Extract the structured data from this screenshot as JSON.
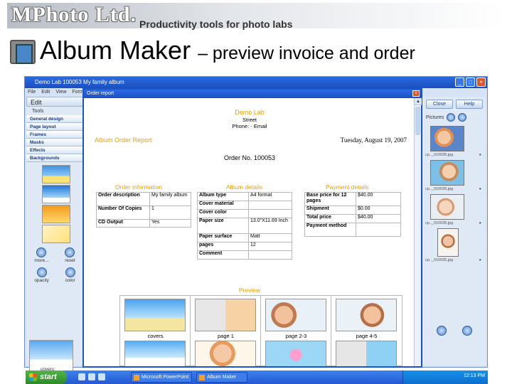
{
  "slide": {
    "logo": "MPhoto Ltd.",
    "tagline": "Productivity tools for photo labs",
    "title": "Album Maker",
    "subtitle": "– preview invoice and order"
  },
  "app": {
    "title": "Demo Lab    100053   My family album",
    "menu": [
      "File",
      "Edit",
      "View",
      "Format"
    ],
    "edit_header": "Edit",
    "tools_label": "Tools",
    "tools": [
      "General design",
      "Page layout",
      "Frames",
      "Masks",
      "Effects",
      "Backgrounds"
    ],
    "more_label": "more...",
    "reset_label": "reset",
    "opacity_label": "opacity",
    "color_label": "color",
    "covers_label": "covers",
    "close_label": "Close",
    "help_label": "Help",
    "pictures_label": "Pictures",
    "picture_names": [
      "cp.._010035.jpg",
      "cp.._010035.jpg",
      "cp.._010035.jpg",
      "cp.._010035.jpg",
      "cp.._010035.jpg"
    ]
  },
  "dialog": {
    "title": "Order report",
    "lab_name": "Demo Lab",
    "street": "Street",
    "phone": "Phone: - Email",
    "report_title": "Album Order Report",
    "date": "Tuesday, August 19, 2007",
    "order_no": "Order No. 100053",
    "order_info": {
      "header": "Order information",
      "rows": [
        {
          "k": "Order description",
          "v": "My family album"
        },
        {
          "k": "Number Of Copies",
          "v": "1"
        },
        {
          "k": "CD Output",
          "v": "Yes"
        }
      ]
    },
    "album_details": {
      "header": "Album details",
      "rows": [
        {
          "k": "Album type",
          "v": "A4 format"
        },
        {
          "k": "Cover material",
          "v": ""
        },
        {
          "k": "Cover color",
          "v": ""
        },
        {
          "k": "Paper size",
          "v": "13.0\"X11.69 Inch"
        },
        {
          "k": "Paper surface",
          "v": "Matt"
        },
        {
          "k": "pages",
          "v": "12"
        },
        {
          "k": "Comment",
          "v": ""
        }
      ]
    },
    "payment_details": {
      "header": "Payment details",
      "rows": [
        {
          "k": "Base price for 12 pages",
          "v": "$40.00"
        },
        {
          "k": "Shipment",
          "v": "$0.00"
        },
        {
          "k": "Total price",
          "v": "$40.00"
        },
        {
          "k": "Payment method",
          "v": ""
        }
      ]
    },
    "preview": {
      "header": "Preview",
      "labels": [
        "covers",
        "page 1",
        "page 2-3",
        "page 4-5"
      ]
    }
  },
  "taskbar": {
    "start": "start",
    "tasks": [
      "Microsoft PowerPoint ...",
      "Album Maker"
    ],
    "clock": "12:13 PM"
  }
}
